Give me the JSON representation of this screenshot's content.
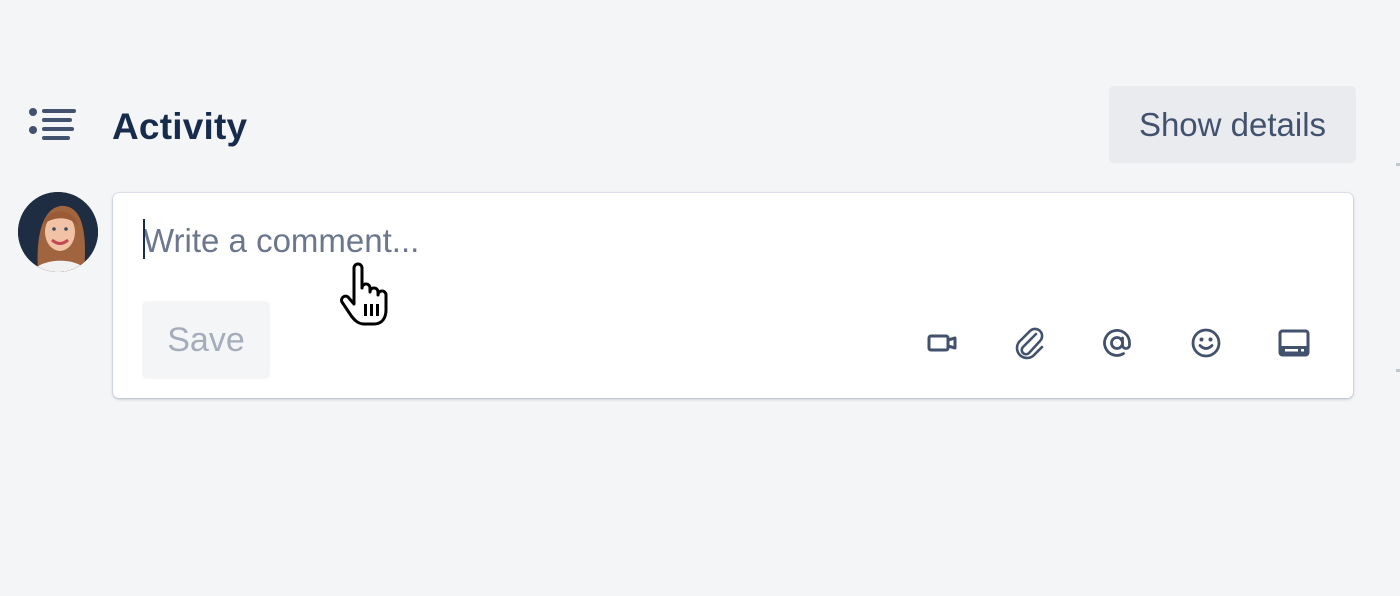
{
  "activity": {
    "title": "Activity",
    "icon": "activity-list-icon",
    "show_details_label": "Show details"
  },
  "comment": {
    "placeholder": "Write a comment...",
    "value": "",
    "save_label": "Save",
    "avatar": "user-avatar-photo",
    "toolbar": [
      {
        "name": "video-icon",
        "label": "Record video"
      },
      {
        "name": "attachment-icon",
        "label": "Add attachment"
      },
      {
        "name": "mention-icon",
        "label": "Mention"
      },
      {
        "name": "emoji-icon",
        "label": "Add emoji"
      },
      {
        "name": "card-icon",
        "label": "Add card"
      }
    ]
  },
  "colors": {
    "background": "#f4f5f7",
    "text_primary": "#172b4d",
    "icon": "#42526e",
    "button_bg": "#e9ebef",
    "save_disabled_text": "#a5adba"
  }
}
